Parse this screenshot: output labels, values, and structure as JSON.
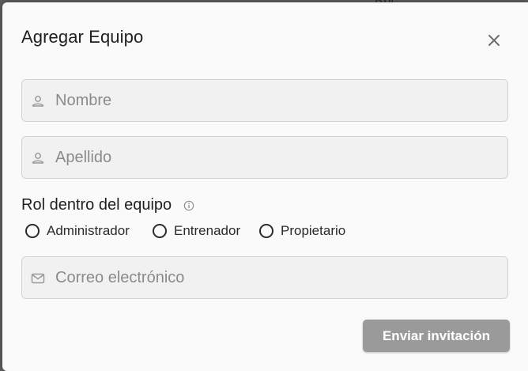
{
  "background": {
    "partial_text": "Rol"
  },
  "dialog": {
    "title": "Agregar Equipo",
    "close_icon": "close-icon",
    "fields": {
      "first_name": {
        "placeholder": "Nombre",
        "value": "",
        "icon": "person-icon"
      },
      "last_name": {
        "placeholder": "Apellido",
        "value": "",
        "icon": "person-icon"
      },
      "email": {
        "placeholder": "Correo electrónico",
        "value": "",
        "icon": "mail-icon"
      }
    },
    "role": {
      "label": "Rol dentro del equipo",
      "info_icon": "info-icon",
      "options": [
        "Administrador",
        "Entrenador",
        "Propietario"
      ],
      "selected": null
    },
    "submit_label": "Enviar invitación"
  },
  "colors": {
    "dialog_bg": "#fafafa",
    "field_bg": "#f1f1f1",
    "button_disabled": "#9a9a9a"
  }
}
